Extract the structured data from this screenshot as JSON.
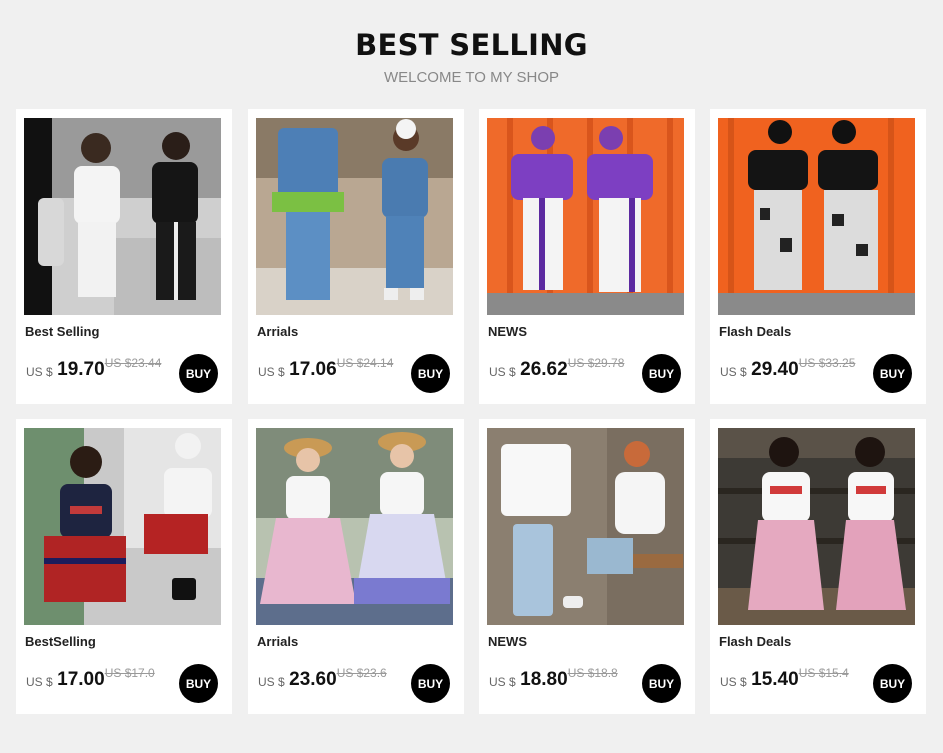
{
  "header": {
    "title": "BEST SELLING",
    "subtitle": "WELCOME TO MY SHOP"
  },
  "colors": {
    "page_bg": "#f0f0f0",
    "card_bg": "#ffffff",
    "buy_button": "#000000",
    "price": "#111111",
    "old_price": "#999999"
  },
  "products": [
    {
      "category": "Best Selling",
      "currency": "US $",
      "price": "19.70",
      "old_price": "US $23.44",
      "buy_label": "BUY",
      "image_icon": "product-photo-icon"
    },
    {
      "category": "Arrials",
      "currency": "US $",
      "price": "17.06",
      "old_price": "US $24.14",
      "buy_label": "BUY",
      "image_icon": "product-photo-icon"
    },
    {
      "category": "NEWS",
      "currency": "US $",
      "price": "26.62",
      "old_price": "US $29.78",
      "buy_label": "BUY",
      "image_icon": "product-photo-icon"
    },
    {
      "category": "Flash Deals",
      "currency": "US $",
      "price": "29.40",
      "old_price": "US $33.25",
      "buy_label": "BUY",
      "image_icon": "product-photo-icon"
    },
    {
      "category": "BestSelling",
      "currency": "US $",
      "price": "17.00",
      "old_price": "US $17.0",
      "buy_label": "BUY",
      "image_icon": "product-photo-icon"
    },
    {
      "category": "Arrials",
      "currency": "US $",
      "price": "23.60",
      "old_price": "US $23.6",
      "buy_label": "BUY",
      "image_icon": "product-photo-icon"
    },
    {
      "category": "NEWS",
      "currency": "US $",
      "price": "18.80",
      "old_price": "US $18.8",
      "buy_label": "BUY",
      "image_icon": "product-photo-icon"
    },
    {
      "category": "Flash Deals",
      "currency": "US $",
      "price": "15.40",
      "old_price": "US $15.4",
      "buy_label": "BUY",
      "image_icon": "product-photo-icon"
    }
  ]
}
